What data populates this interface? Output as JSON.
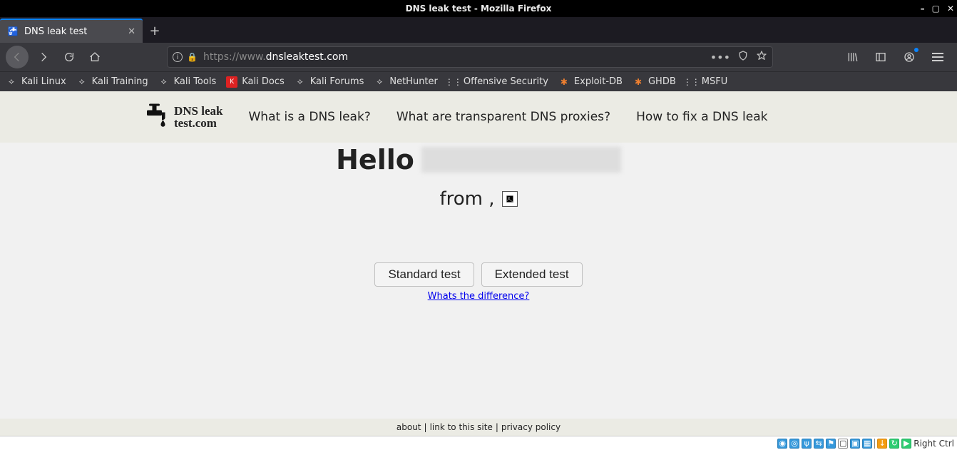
{
  "window": {
    "title": "DNS leak test - Mozilla Firefox"
  },
  "tab": {
    "title": "DNS leak test",
    "favicon": "faucet-icon"
  },
  "url": {
    "prefix": "https://www.",
    "highlight": "dnsleaktest.com",
    "suffix": ""
  },
  "bookmarks": [
    {
      "label": "Kali Linux",
      "icon": "kali"
    },
    {
      "label": "Kali Training",
      "icon": "kali"
    },
    {
      "label": "Kali Tools",
      "icon": "kali"
    },
    {
      "label": "Kali Docs",
      "icon": "docs"
    },
    {
      "label": "Kali Forums",
      "icon": "kali"
    },
    {
      "label": "NetHunter",
      "icon": "kali"
    },
    {
      "label": "Offensive Security",
      "icon": "offsec"
    },
    {
      "label": "Exploit-DB",
      "icon": "orange"
    },
    {
      "label": "GHDB",
      "icon": "orange"
    },
    {
      "label": "MSFU",
      "icon": "offsec"
    }
  ],
  "site": {
    "logo_line1": "DNS leak",
    "logo_line2": "test.com",
    "nav": [
      "What is a DNS leak?",
      "What are transparent DNS proxies?",
      "How to fix a DNS leak"
    ],
    "hello": "Hello",
    "from": "from ,",
    "standard_btn": "Standard test",
    "extended_btn": "Extended test",
    "diff_link": "Whats the difference?",
    "footer": {
      "about": "about",
      "link": "link to this site",
      "privacy": "privacy policy"
    }
  },
  "host": {
    "label": "Right Ctrl"
  }
}
